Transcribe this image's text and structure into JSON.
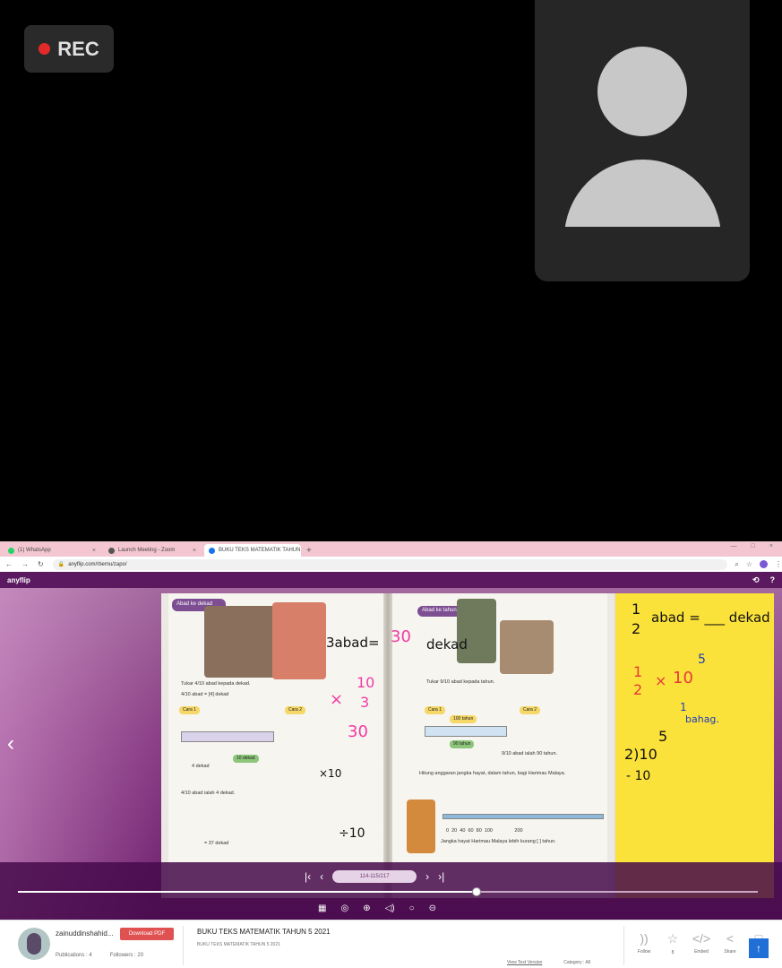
{
  "meeting": {
    "rec_label": "REC"
  },
  "browser": {
    "tabs": [
      {
        "label": "(1) WhatsApp",
        "favicon_color": "#25d366"
      },
      {
        "label": "Launch Meeting - Zoom",
        "favicon_color": "#555555"
      },
      {
        "label": "BUKU TEKS MATEMATIK TAHUN",
        "favicon_color": "#1a73e8"
      }
    ],
    "new_tab_label": "+",
    "url": "anyflip.com/rbemu/zapo/"
  },
  "anyflip": {
    "logo": "anyflip",
    "page_indicator": "114-115/217",
    "progress_fraction": 0.62,
    "book": {
      "left_header": "Abad ke dekad",
      "right_header": "Abad ke tahun",
      "left_caption": "Tukar 4/10 abad kepada dekad.",
      "left_result": "4/10 abad = [4] dekad",
      "left_answer": "4/10 abad ialah 4 dekad.",
      "left_cara1": "Cara 1",
      "left_cara2": "Cara 2",
      "left_dekad_label": "10 dekad",
      "left_four_dekad": "4 dekad",
      "left_eq_37": "= 37 dekad",
      "right_caption": "Tukar 9/10 abad kepada tahun.",
      "right_100": "100 tahun",
      "right_90": "90 tahun",
      "right_answer": "9/10 abad ialah 90 tahun.",
      "right_cara1": "Cara 1",
      "right_cara2": "Cara 2",
      "right_q2": "Hitung anggaran jangka hayat, dalam tahun, bagi Harimau Malaya.",
      "right_axis": "0  20  40  60  80  100                200",
      "right_bottom": "Jangka hayat Harimau Malaya lebih kurang [ ] tahun."
    },
    "handwriting": {
      "main_eq": "3abad=",
      "main_blank": "30",
      "main_unit": "dekad",
      "mult_10": "10",
      "mult_x": "×",
      "mult_3": "3",
      "mult_30": "30",
      "x10": "×10",
      "div10": "÷10"
    },
    "note": {
      "q_fraction_num": "1",
      "q_fraction_den": "2",
      "q_text": "abad = ___ dekad",
      "red_num": "1",
      "red_den": "2",
      "times": "×",
      "ten": "10",
      "five": "5",
      "one": "1",
      "bahagi": "bahag.",
      "division_quotient": "5",
      "division": "2)10",
      "minus": "- 10"
    }
  },
  "footer": {
    "username": "zainuddinshahid...",
    "download_label": "Download PDF",
    "publications": "Publications : 4",
    "followers": "Followers : 20",
    "book_title": "BUKU TEKS MATEMATIK TAHUN 5 2021",
    "book_subtitle": "BUKU TEKS MATEMATIK TAHUN 5 2021",
    "view_text": "View Text Version",
    "category": "Category : All",
    "actions": [
      "Follow",
      "8",
      "Embed",
      "Share",
      "Up"
    ]
  }
}
